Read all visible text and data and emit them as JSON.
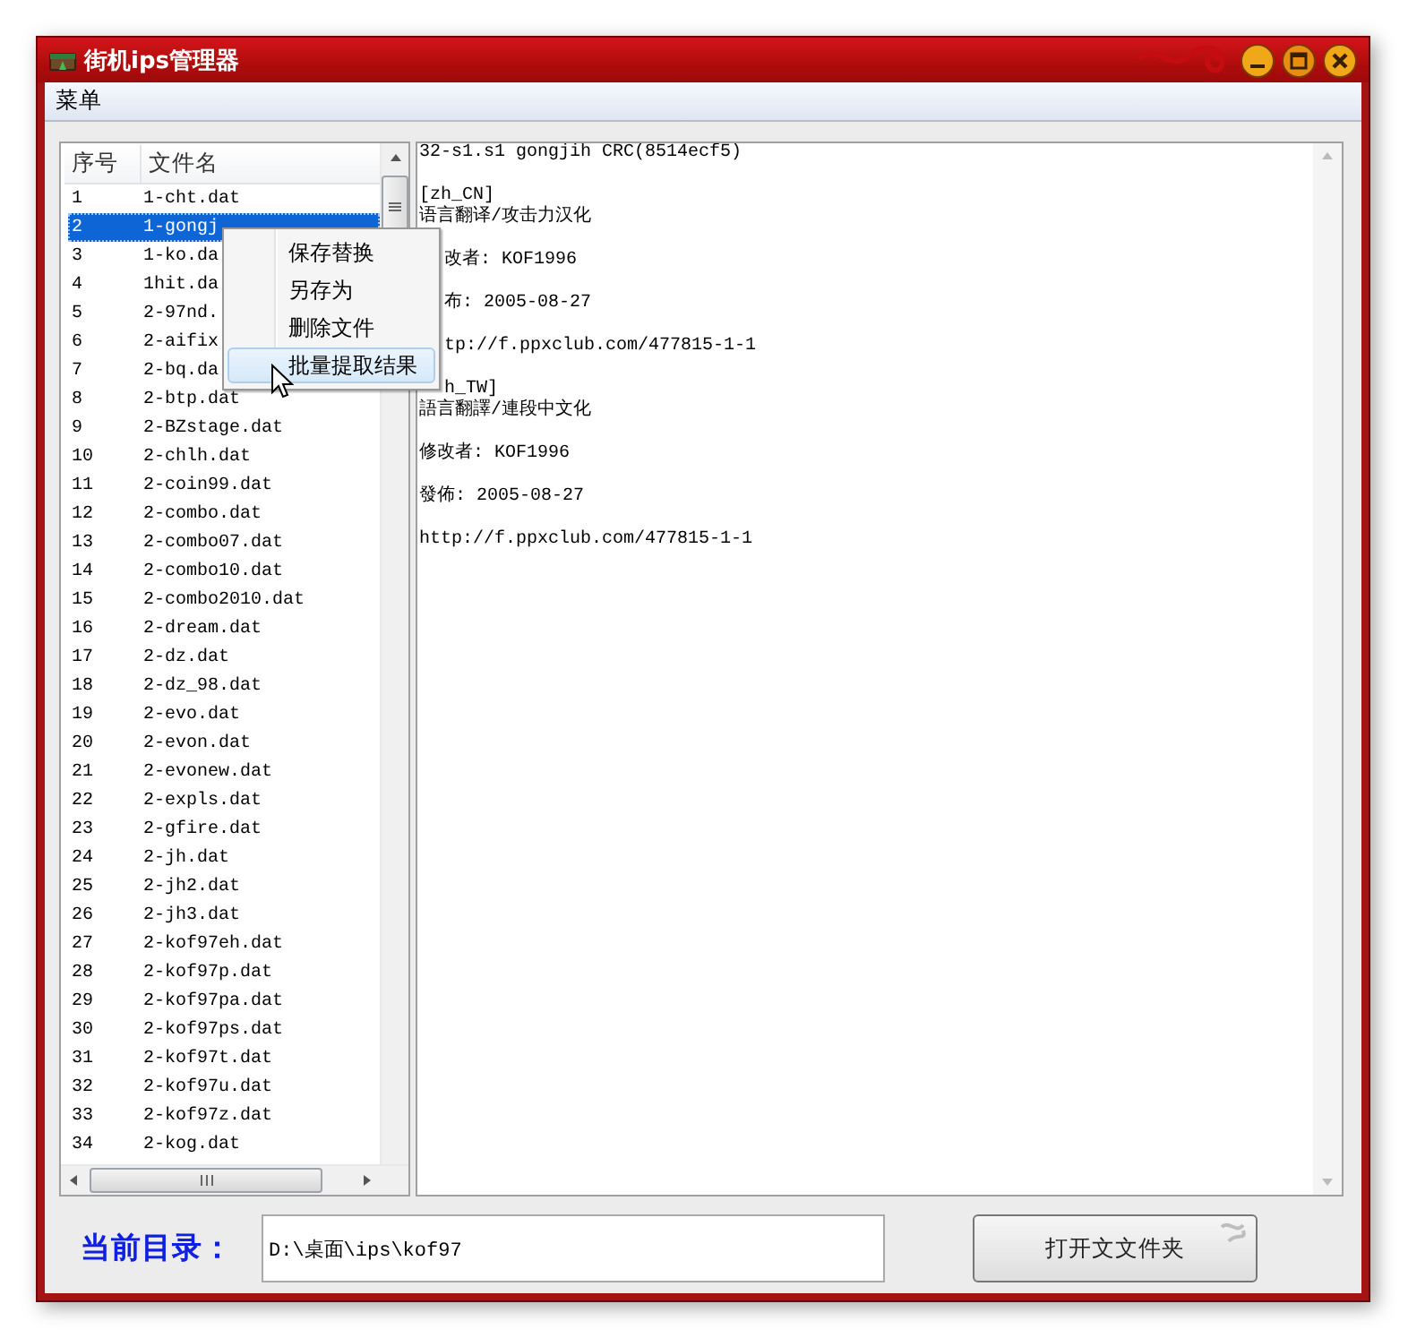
{
  "window": {
    "title": "街机ips管理器"
  },
  "menu_bar": [
    {
      "label": "菜单"
    }
  ],
  "file_list": {
    "columns": [
      "序号",
      "文件名"
    ],
    "rows": [
      {
        "index": "1",
        "name": "1-cht.dat",
        "selected": false
      },
      {
        "index": "2",
        "name": "1-gongj",
        "selected": true
      },
      {
        "index": "3",
        "name": "1-ko.da",
        "selected": false
      },
      {
        "index": "4",
        "name": "1hit.da",
        "selected": false
      },
      {
        "index": "5",
        "name": "2-97nd.",
        "selected": false
      },
      {
        "index": "6",
        "name": "2-aifix",
        "selected": false
      },
      {
        "index": "7",
        "name": "2-bq.da",
        "selected": false
      },
      {
        "index": "8",
        "name": "2-btp.dat",
        "selected": false
      },
      {
        "index": "9",
        "name": "2-BZstage.dat",
        "selected": false
      },
      {
        "index": "10",
        "name": "2-chlh.dat",
        "selected": false
      },
      {
        "index": "11",
        "name": "2-coin99.dat",
        "selected": false
      },
      {
        "index": "12",
        "name": "2-combo.dat",
        "selected": false
      },
      {
        "index": "13",
        "name": "2-combo07.dat",
        "selected": false
      },
      {
        "index": "14",
        "name": "2-combo10.dat",
        "selected": false
      },
      {
        "index": "15",
        "name": "2-combo2010.dat",
        "selected": false
      },
      {
        "index": "16",
        "name": "2-dream.dat",
        "selected": false
      },
      {
        "index": "17",
        "name": "2-dz.dat",
        "selected": false
      },
      {
        "index": "18",
        "name": "2-dz_98.dat",
        "selected": false
      },
      {
        "index": "19",
        "name": "2-evo.dat",
        "selected": false
      },
      {
        "index": "20",
        "name": "2-evon.dat",
        "selected": false
      },
      {
        "index": "21",
        "name": "2-evonew.dat",
        "selected": false
      },
      {
        "index": "22",
        "name": "2-expls.dat",
        "selected": false
      },
      {
        "index": "23",
        "name": "2-gfire.dat",
        "selected": false
      },
      {
        "index": "24",
        "name": "2-jh.dat",
        "selected": false
      },
      {
        "index": "25",
        "name": "2-jh2.dat",
        "selected": false
      },
      {
        "index": "26",
        "name": "2-jh3.dat",
        "selected": false
      },
      {
        "index": "27",
        "name": "2-kof97eh.dat",
        "selected": false
      },
      {
        "index": "28",
        "name": "2-kof97p.dat",
        "selected": false
      },
      {
        "index": "29",
        "name": "2-kof97pa.dat",
        "selected": false
      },
      {
        "index": "30",
        "name": "2-kof97ps.dat",
        "selected": false
      },
      {
        "index": "31",
        "name": "2-kof97t.dat",
        "selected": false
      },
      {
        "index": "32",
        "name": "2-kof97u.dat",
        "selected": false
      },
      {
        "index": "33",
        "name": "2-kof97z.dat",
        "selected": false
      },
      {
        "index": "34",
        "name": "2-kog.dat",
        "selected": false
      }
    ]
  },
  "context_menu": {
    "items": [
      {
        "label": "保存替换",
        "selected": false
      },
      {
        "label": "另存为",
        "selected": false
      },
      {
        "label": "删除文件",
        "selected": false
      },
      {
        "label": "批量提取结果",
        "selected": true
      }
    ]
  },
  "preview": {
    "lines": [
      {
        "kind": "text",
        "text": "32-s1.s1        gongjih CRC(8514ecf5)",
        "covered": false
      },
      {
        "kind": "section",
        "text": "[zh_CN]",
        "covered": false
      },
      {
        "kind": "text",
        "text": "语言翻译/攻击力汉化",
        "covered": false
      },
      {
        "kind": "text",
        "text": "改者: KOF1996",
        "covered": true
      },
      {
        "kind": "text",
        "text": "布: 2005-08-27",
        "covered": true
      },
      {
        "kind": "text",
        "text": "tp://f.ppxclub.com/477815-1-1",
        "covered": true
      },
      {
        "kind": "section",
        "text": "h_TW]",
        "covered": true
      },
      {
        "kind": "text",
        "text": "語言翻譯/連段中文化",
        "covered": false
      },
      {
        "kind": "text",
        "text": "修改者: KOF1996",
        "covered": false
      },
      {
        "kind": "text",
        "text": "發佈: 2005-08-27",
        "covered": false
      },
      {
        "kind": "text",
        "text": "http://f.ppxclub.com/477815-1-1",
        "covered": false
      }
    ]
  },
  "directory": {
    "label": "当前目录：",
    "value": "D:\\桌面\\ips\\kof97"
  },
  "open_button": {
    "label": "打开文文件夹"
  }
}
